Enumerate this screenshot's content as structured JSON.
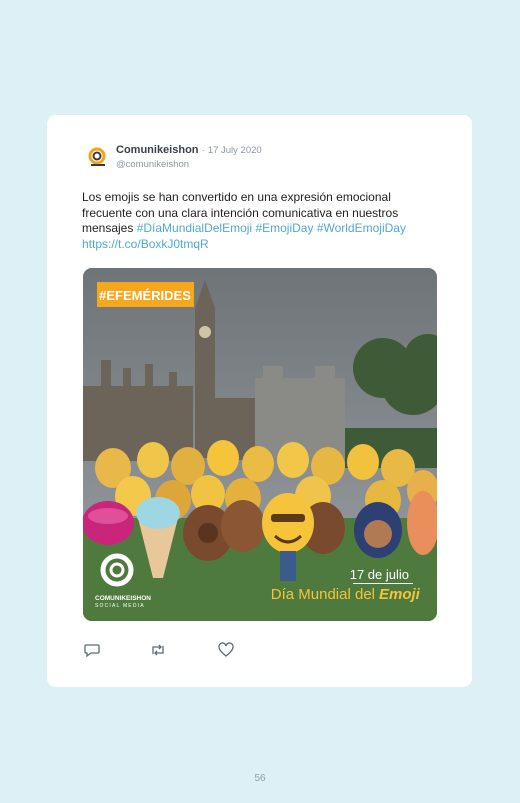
{
  "tweet": {
    "author_name": "Comunikeishon",
    "separator": "·",
    "date": "17 July 2020",
    "handle": "@comunikeishon",
    "text_plain": "Los emojis se han convertido en una expresión emocional frecuente con una clara intención comunicativa en nuestros mensajes",
    "hashtags": [
      "#DíaMundialDelEmoji",
      "#EmojiDay",
      "#WorldEmojiDay"
    ],
    "short_link": "https://t.co/BoxkJ0tmqR"
  },
  "media": {
    "badge": "#EFEMÉRIDES",
    "logo_text": "COMUNIKEISHON",
    "logo_sub": "SOCIAL MEDIA",
    "date_line": "17 de julio",
    "event_prefix": "Día Mundial del",
    "event_word": "Emoji"
  },
  "icons": {
    "reply": "reply-icon",
    "retweet": "retweet-icon",
    "like": "heart-icon"
  },
  "colors": {
    "background": "#dcf0f6",
    "link": "#4fa8d8",
    "badge": "#f5a81c",
    "emoji_yellow": "#f5c43a"
  },
  "page_number": "56"
}
